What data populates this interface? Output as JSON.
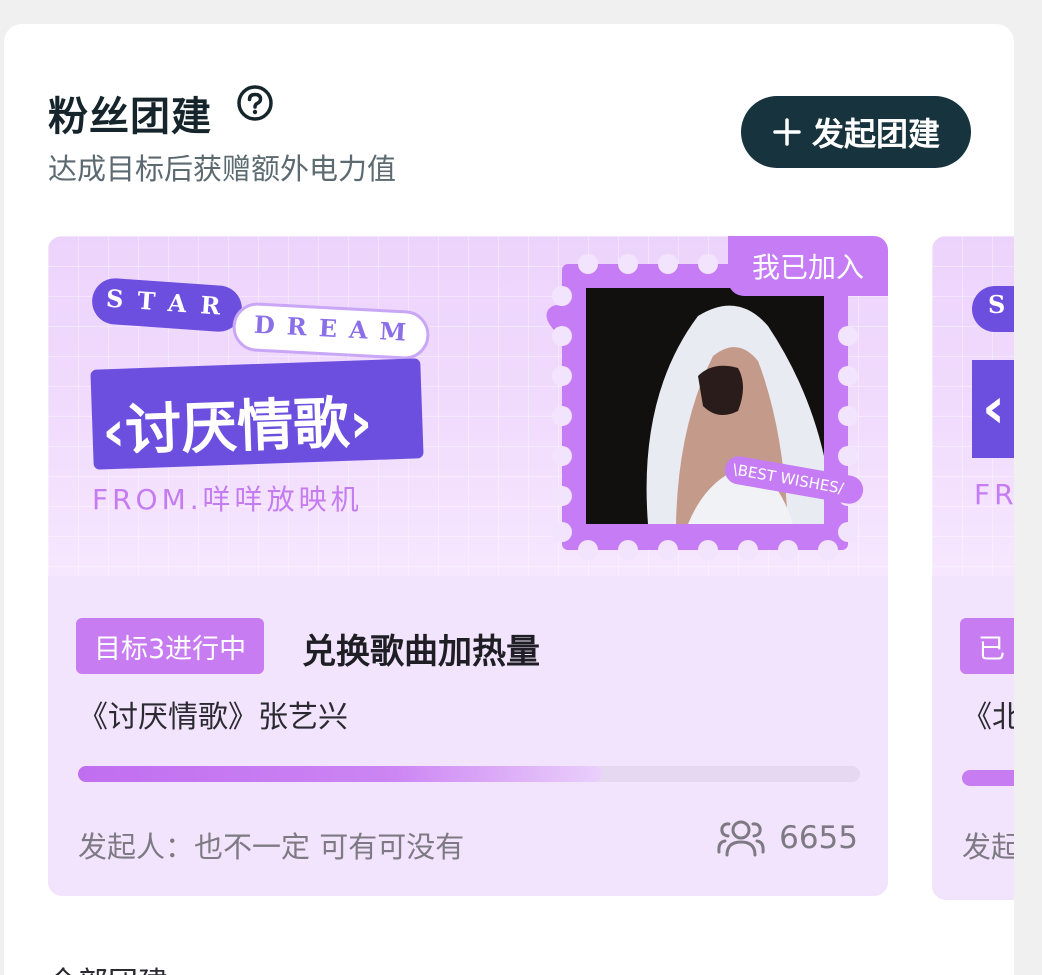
{
  "header": {
    "title": "粉丝团建",
    "subtitle": "达成目标后获赠额外电力值",
    "create_button_label": "发起团建"
  },
  "cards": [
    {
      "joined_badge": "我已加入",
      "banner": {
        "star_word": "STAR",
        "dream_word": "DREAM",
        "song_title": "‹讨厌情歌›",
        "from_text": "FROM.咩咩放映机",
        "stamp_text": "\\BEST WISHES/"
      },
      "goal_tag": "目标3进行中",
      "goal_title": "兑换歌曲加热量",
      "song_line": "《讨厌情歌》张艺兴",
      "progress_percent": 67,
      "organizer": "发起人：也不一定 可有可没有",
      "member_count": "6655"
    },
    {
      "banner": {
        "star_word": "S",
        "song_title": "‹",
        "from_text": "FR"
      },
      "goal_tag": "已",
      "song_line": "《‍北",
      "organizer": "发起"
    }
  ],
  "footer": {
    "all_link": "全部团建 ›"
  },
  "colors": {
    "accent_purple": "#c77cf1",
    "dark_button": "#17333e",
    "banner_purple": "#6d4fe0"
  }
}
